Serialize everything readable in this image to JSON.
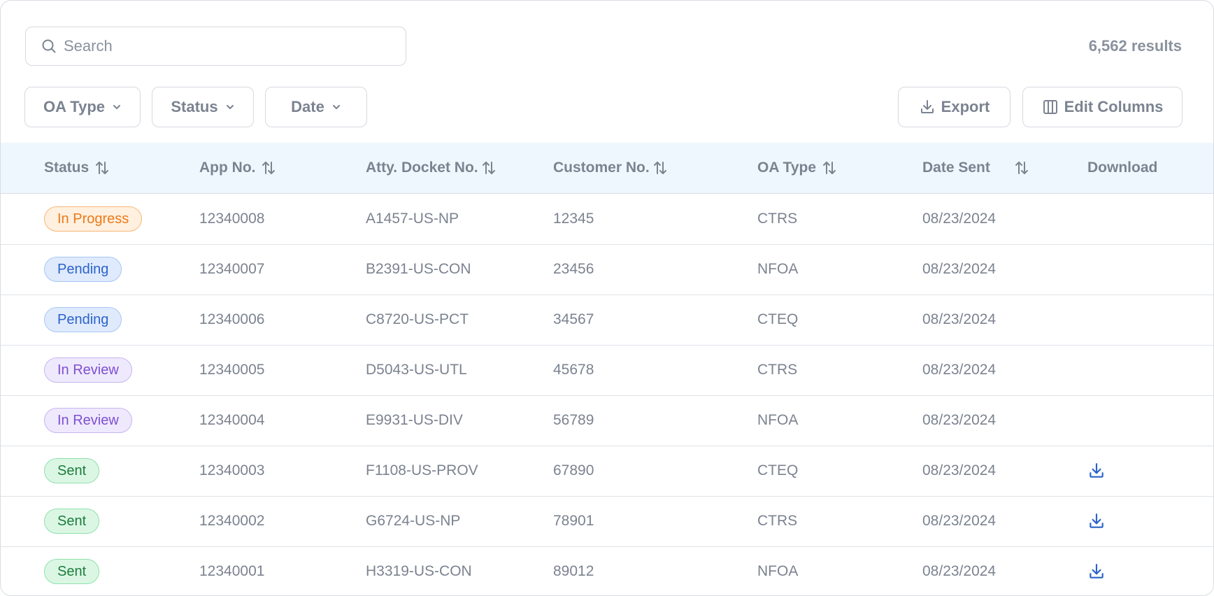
{
  "search": {
    "placeholder": "Search",
    "value": ""
  },
  "results_text": "6,562 results",
  "filters": [
    {
      "label": "OA Type"
    },
    {
      "label": "Status"
    },
    {
      "label": "Date"
    }
  ],
  "actions": {
    "export_label": "Export",
    "edit_columns_label": "Edit Columns"
  },
  "columns": [
    "Status",
    "App No.",
    "Atty. Docket No.",
    "Customer No.",
    "OA Type",
    "Date Sent",
    "Download"
  ],
  "rows": [
    {
      "status": "In Progress",
      "status_kind": "progress",
      "app_no": "12340008",
      "docket": "A1457-US-NP",
      "customer": "12345",
      "oa_type": "CTRS",
      "date_sent": "08/23/2024",
      "download": false
    },
    {
      "status": "Pending",
      "status_kind": "pending",
      "app_no": "12340007",
      "docket": "B2391-US-CON",
      "customer": "23456",
      "oa_type": "NFOA",
      "date_sent": "08/23/2024",
      "download": false
    },
    {
      "status": "Pending",
      "status_kind": "pending",
      "app_no": "12340006",
      "docket": "C8720-US-PCT",
      "customer": "34567",
      "oa_type": "CTEQ",
      "date_sent": "08/23/2024",
      "download": false
    },
    {
      "status": "In Review",
      "status_kind": "review",
      "app_no": "12340005",
      "docket": "D5043-US-UTL",
      "customer": "45678",
      "oa_type": "CTRS",
      "date_sent": "08/23/2024",
      "download": false
    },
    {
      "status": "In Review",
      "status_kind": "review",
      "app_no": "12340004",
      "docket": "E9931-US-DIV",
      "customer": "56789",
      "oa_type": "NFOA",
      "date_sent": "08/23/2024",
      "download": false
    },
    {
      "status": "Sent",
      "status_kind": "sent",
      "app_no": "12340003",
      "docket": "F1108-US-PROV",
      "customer": "67890",
      "oa_type": "CTEQ",
      "date_sent": "08/23/2024",
      "download": true
    },
    {
      "status": "Sent",
      "status_kind": "sent",
      "app_no": "12340002",
      "docket": "G6724-US-NP",
      "customer": "78901",
      "oa_type": "CTRS",
      "date_sent": "08/23/2024",
      "download": true
    },
    {
      "status": "Sent",
      "status_kind": "sent",
      "app_no": "12340001",
      "docket": "H3319-US-CON",
      "customer": "89012",
      "oa_type": "NFOA",
      "date_sent": "08/23/2024",
      "download": true
    }
  ],
  "icons": {
    "search": "search-icon",
    "chevron": "chevron-down-icon",
    "export": "download-icon",
    "edit_columns": "columns-icon",
    "sort": "sort-icon",
    "row_download": "download-icon"
  },
  "colors": {
    "header_bg": "#eef7fd",
    "download_icon": "#2b63c9",
    "in_progress": "#ea7a1a",
    "pending": "#2b63c9",
    "in_review": "#7e4fd1",
    "sent": "#1d7d3c"
  }
}
